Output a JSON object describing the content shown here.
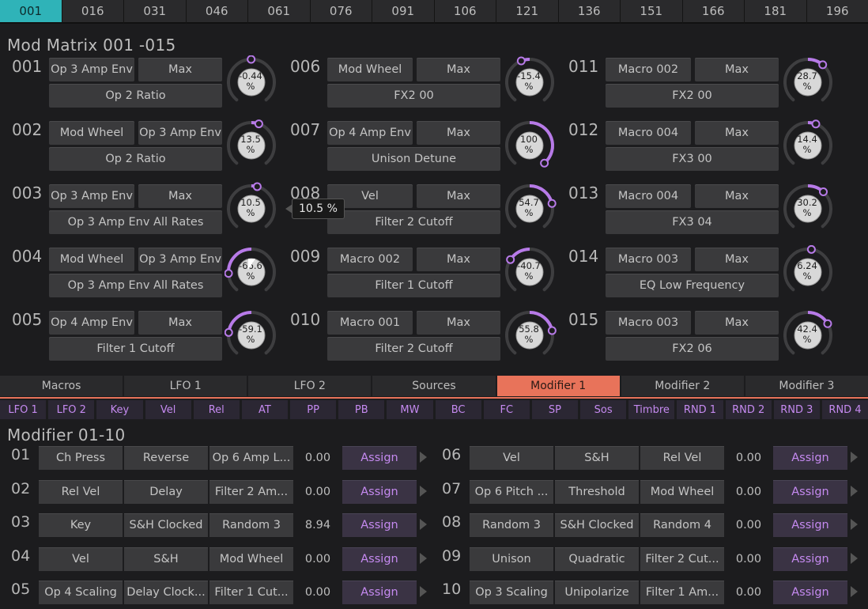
{
  "page_tabs": [
    "001",
    "016",
    "031",
    "046",
    "061",
    "076",
    "091",
    "106",
    "121",
    "136",
    "151",
    "166",
    "181",
    "196"
  ],
  "active_page_tab": 0,
  "mod_matrix": {
    "title": "Mod Matrix 001 -015",
    "slots": [
      {
        "num": "001",
        "source": "Op 3 Amp Env",
        "amount": "Max",
        "dest": "Op 2 Ratio",
        "value": "-0.44",
        "unit": "%",
        "level": -0.0044
      },
      {
        "num": "002",
        "source": "Mod Wheel",
        "amount": "Op 3 Amp Env",
        "dest": "Op 2 Ratio",
        "value": "13.5",
        "unit": "%",
        "level": 0.135
      },
      {
        "num": "003",
        "source": "Op 3 Amp Env",
        "amount": "Max",
        "dest": "Op 3 Amp Env All Rates",
        "value": "10.5",
        "unit": "%",
        "level": 0.105
      },
      {
        "num": "004",
        "source": "Mod Wheel",
        "amount": "Op 3 Amp Env",
        "dest": "Op 3 Amp Env All Rates",
        "value": "-66.6",
        "unit": "%",
        "level": -0.666
      },
      {
        "num": "005",
        "source": "Op 4 Amp Env",
        "amount": "Max",
        "dest": "Filter 1 Cutoff",
        "value": "-59.1",
        "unit": "%",
        "level": -0.591
      },
      {
        "num": "006",
        "source": "Mod Wheel",
        "amount": "Max",
        "dest": "FX2 00",
        "value": "-15.4",
        "unit": "%",
        "level": -0.154
      },
      {
        "num": "007",
        "source": "Op 4 Amp Env",
        "amount": "Max",
        "dest": "Unison Detune",
        "value": "100",
        "unit": "%",
        "level": 1.0
      },
      {
        "num": "008",
        "source": "Vel",
        "amount": "Max",
        "dest": "Filter 2 Cutoff",
        "value": "54.7",
        "unit": "%",
        "level": 0.547
      },
      {
        "num": "009",
        "source": "Macro 002",
        "amount": "Max",
        "dest": "Filter 1 Cutoff",
        "value": "-40.7",
        "unit": "%",
        "level": -0.407
      },
      {
        "num": "010",
        "source": "Macro 001",
        "amount": "Max",
        "dest": "Filter 2 Cutoff",
        "value": "55.8",
        "unit": "%",
        "level": 0.558
      },
      {
        "num": "011",
        "source": "Macro 002",
        "amount": "Max",
        "dest": "FX2 00",
        "value": "28.7",
        "unit": "%",
        "level": 0.287
      },
      {
        "num": "012",
        "source": "Macro 004",
        "amount": "Max",
        "dest": "FX3 00",
        "value": "14.4",
        "unit": "%",
        "level": 0.144
      },
      {
        "num": "013",
        "source": "Macro 004",
        "amount": "Max",
        "dest": "FX3 04",
        "value": "30.2",
        "unit": "%",
        "level": 0.302
      },
      {
        "num": "014",
        "source": "Macro 003",
        "amount": "Max",
        "dest": "EQ Low Frequency",
        "value": "6.24",
        "unit": "%",
        "level": 0.0624
      },
      {
        "num": "015",
        "source": "Macro 003",
        "amount": "Max",
        "dest": "FX2 06",
        "value": "42.4",
        "unit": "%",
        "level": 0.424
      }
    ],
    "tooltip": "10.5 %"
  },
  "section_tabs": [
    "Macros",
    "LFO 1",
    "LFO 2",
    "Sources",
    "Modifier 1",
    "Modifier 2",
    "Modifier 3"
  ],
  "active_section_tab": 4,
  "source_tabs": [
    "LFO 1",
    "LFO 2",
    "Key",
    "Vel",
    "Rel",
    "AT",
    "PP",
    "PB",
    "MW",
    "BC",
    "FC",
    "SP",
    "Sos",
    "Timbre",
    "RND 1",
    "RND 2",
    "RND 3",
    "RND 4"
  ],
  "modifiers": {
    "title": "Modifier 01-10",
    "assign_label": "Assign",
    "rows": [
      {
        "num": "01",
        "a": "Ch Press",
        "op": "Reverse",
        "b": "Op 6 Amp L...",
        "value": "0.00"
      },
      {
        "num": "02",
        "a": "Rel Vel",
        "op": "Delay",
        "b": "Filter 2 Am...",
        "value": "0.00"
      },
      {
        "num": "03",
        "a": "Key",
        "op": "S&H Clocked",
        "b": "Random 3",
        "value": "8.94"
      },
      {
        "num": "04",
        "a": "Vel",
        "op": "S&H",
        "b": "Mod Wheel",
        "value": "0.00"
      },
      {
        "num": "05",
        "a": "Op 4 Scaling",
        "op": "Delay Clock...",
        "b": "Filter 1 Cut...",
        "value": "0.00"
      },
      {
        "num": "06",
        "a": "Vel",
        "op": "S&H",
        "b": "Rel Vel",
        "value": "0.00"
      },
      {
        "num": "07",
        "a": "Op 6 Pitch ...",
        "op": "Threshold",
        "b": "Mod Wheel",
        "value": "0.00"
      },
      {
        "num": "08",
        "a": "Random 3",
        "op": "S&H Clocked",
        "b": "Random 4",
        "value": "0.00"
      },
      {
        "num": "09",
        "a": "Unison",
        "op": "Quadratic",
        "b": "Filter 2 Cut...",
        "value": "0.00"
      },
      {
        "num": "10",
        "a": "Op 3 Scaling",
        "op": "Unipolarize",
        "b": "Filter 1 Am...",
        "value": "0.00"
      }
    ]
  },
  "colors": {
    "accent_teal": "#2fb3b8",
    "accent_orange": "#e8735a",
    "accent_purple": "#b77ae8"
  }
}
